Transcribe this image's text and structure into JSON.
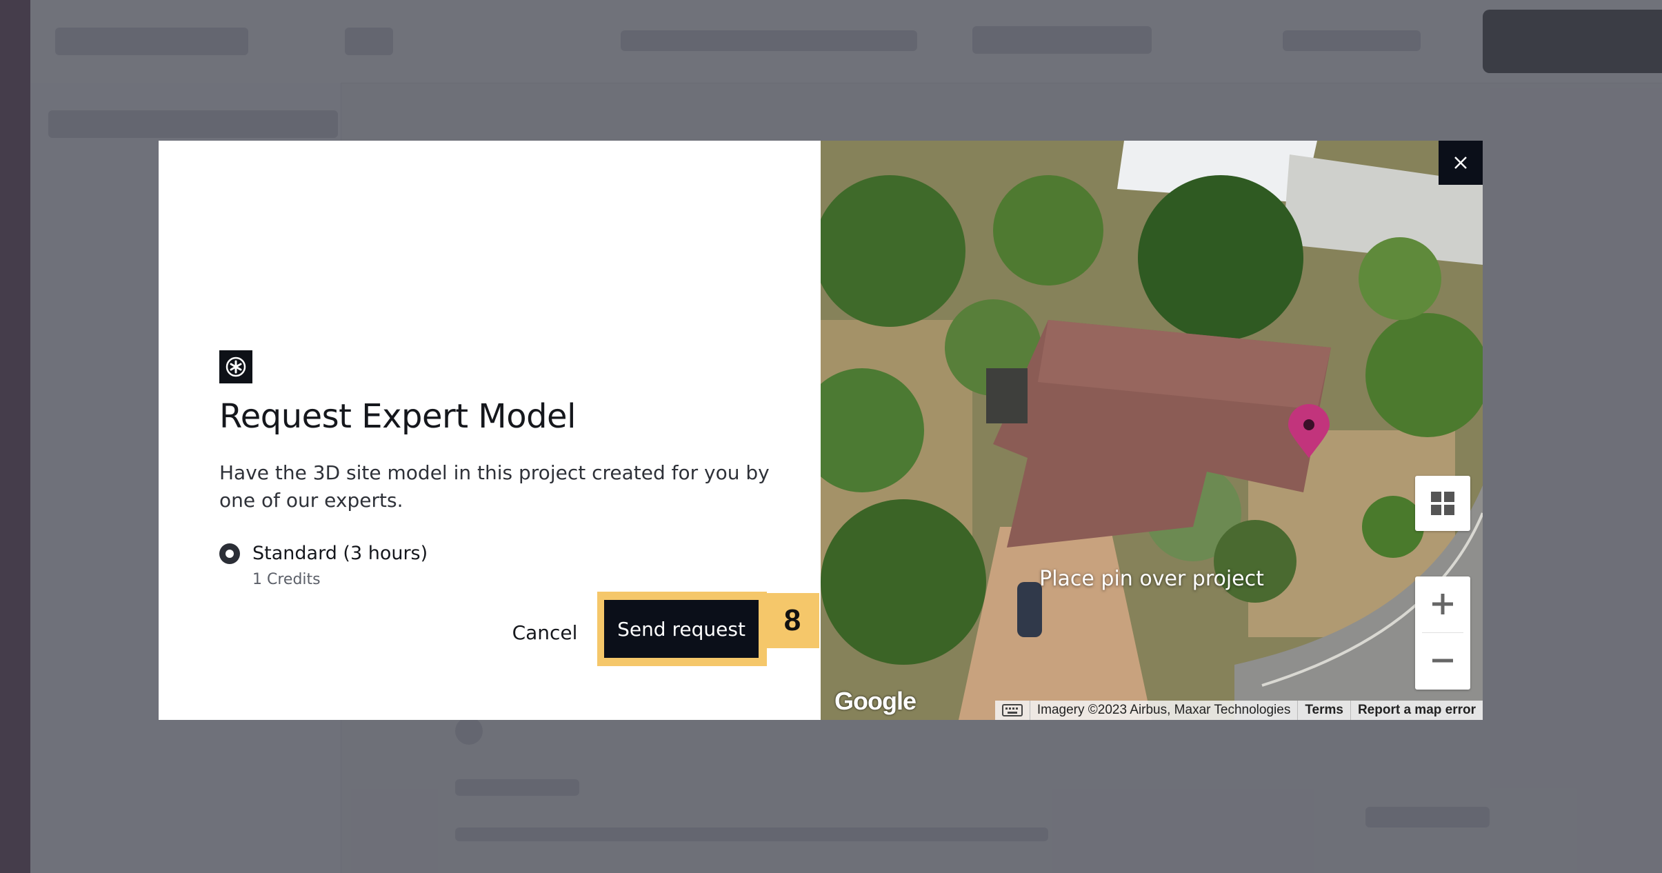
{
  "modal": {
    "title": "Request Expert Model",
    "description": "Have the 3D site model in this project created for you by one of our experts.",
    "option": {
      "label": "Standard (3 hours)",
      "sub": "1 Credits",
      "selected": true
    },
    "cancel_label": "Cancel",
    "send_label": "Send request",
    "badge_number": "8"
  },
  "map": {
    "pin_hint": "Place pin over project",
    "google_logo": "Google",
    "attribution": {
      "imagery": "Imagery ©2023 Airbus, Maxar Technologies",
      "terms": "Terms",
      "report": "Report a map error"
    },
    "pin_color": "#c2347c"
  },
  "colors": {
    "primary_dark": "#0b0f19",
    "highlight": "#f5c76a"
  }
}
